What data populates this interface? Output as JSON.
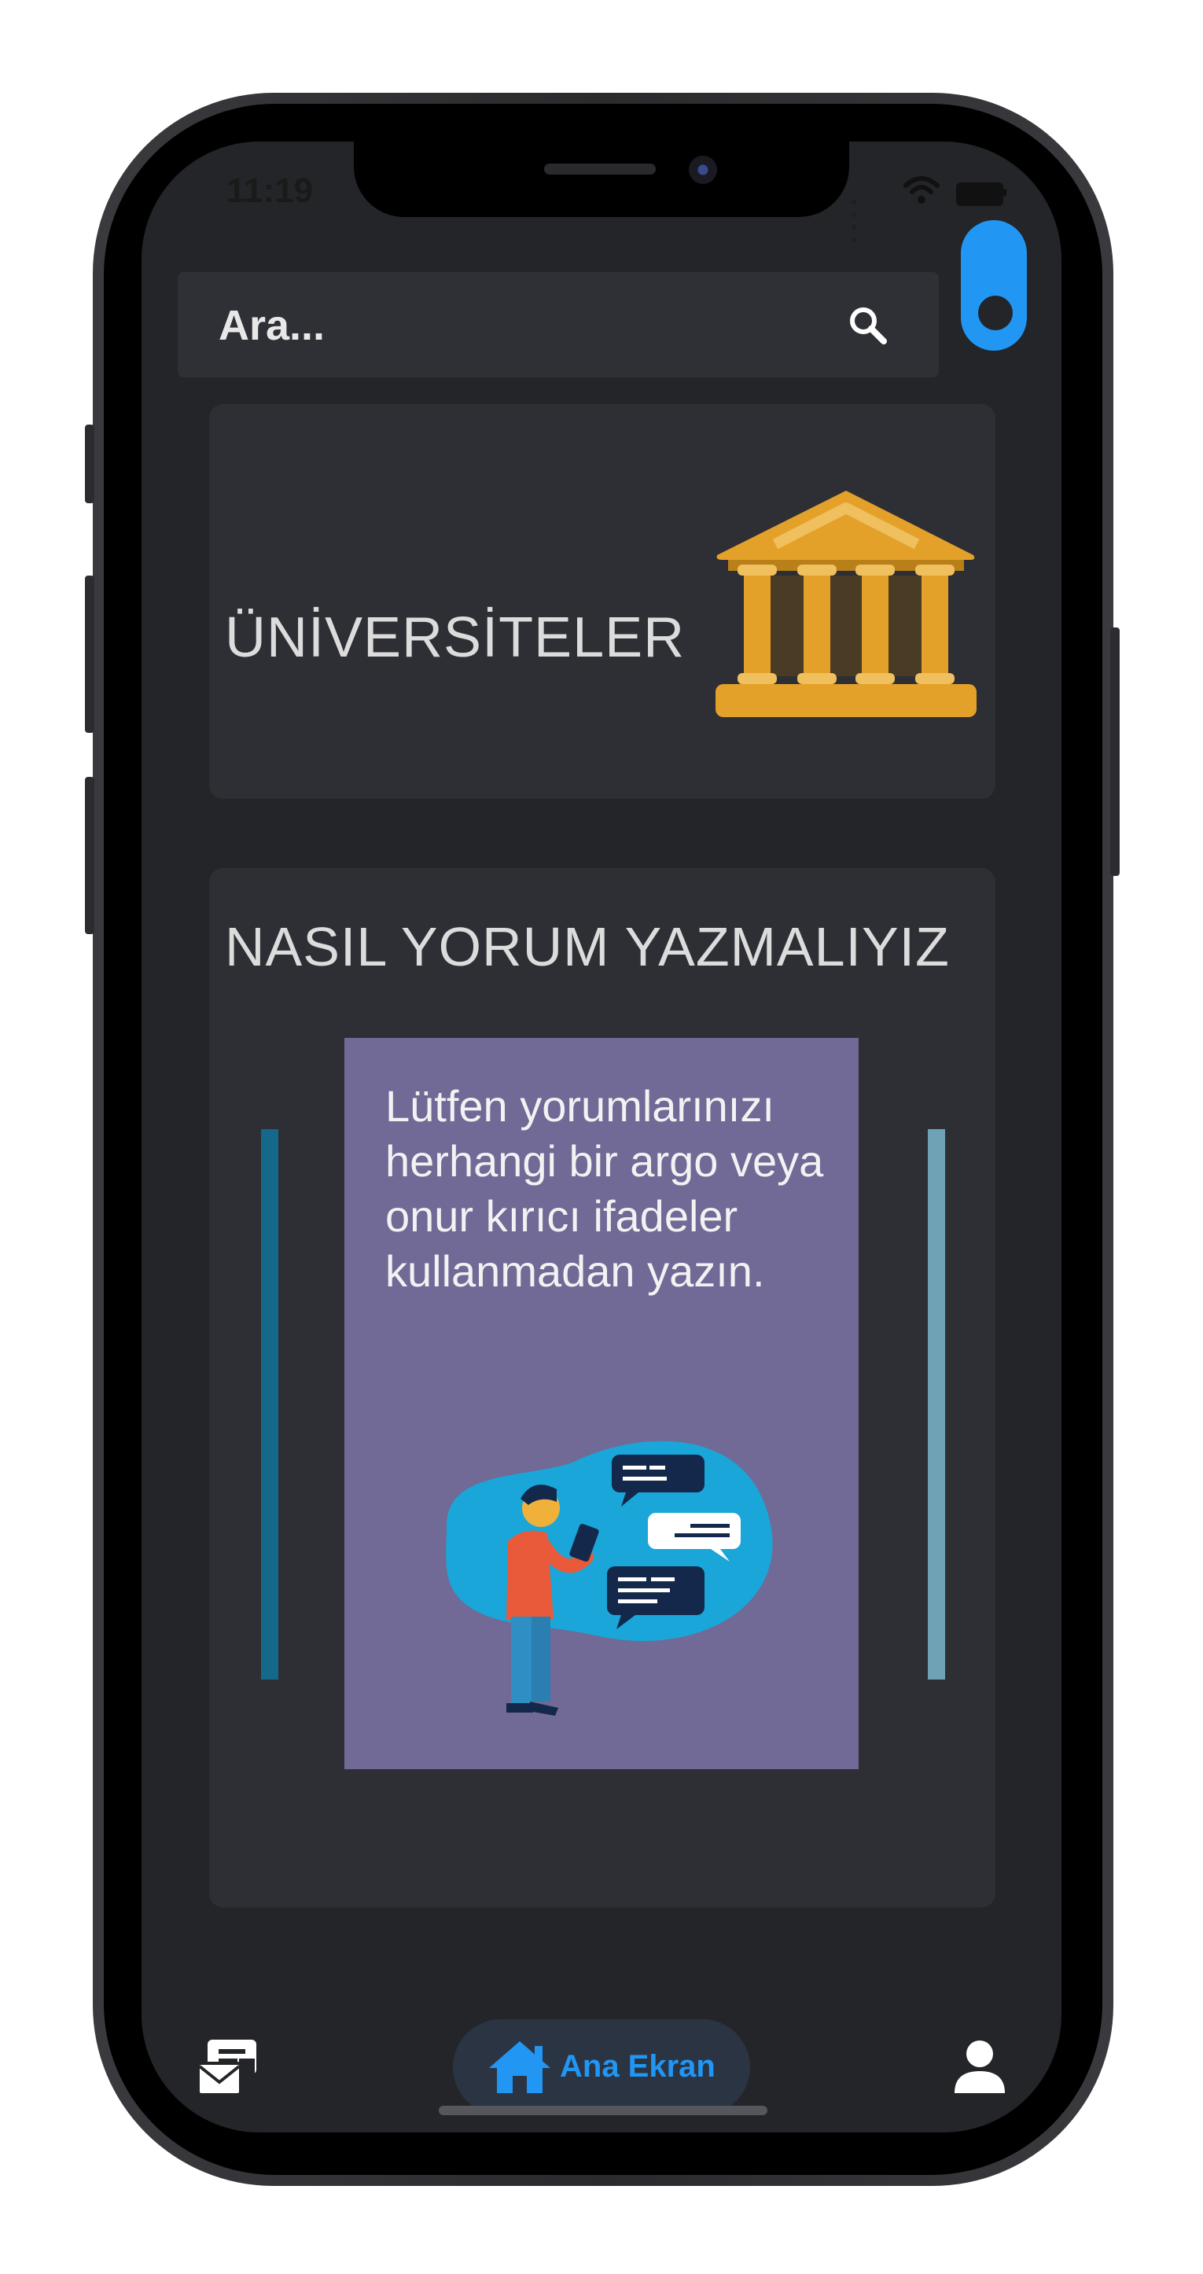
{
  "status_bar": {
    "time": "11:19",
    "signal_icon": "signal-dots-icon",
    "wifi_icon": "wifi-icon",
    "battery_icon": "battery-icon"
  },
  "search": {
    "placeholder": "Ara...",
    "value": "",
    "icon": "search-icon"
  },
  "theme_toggle": {
    "icon": "toggle-switch",
    "color": "#2196f3"
  },
  "universities_card": {
    "title": "ÜNİVERSİTELER",
    "icon": "university-building-icon",
    "icon_color": "#e4a12a"
  },
  "tips_card": {
    "title": "NASIL YORUM YAZMALIYIZ",
    "slide": {
      "text": "Lütfen yorumlarınızı herhangi bir argo veya onur kırıcı ifadeler kullanmadan yazın.",
      "illustration": "person-reading-chat-illustration",
      "background": "#716996"
    }
  },
  "bottom_nav": {
    "messages_icon": "messages-icon",
    "home": {
      "label": "Ana Ekran",
      "icon": "home-icon",
      "color": "#2196f3"
    },
    "profile_icon": "profile-icon"
  }
}
